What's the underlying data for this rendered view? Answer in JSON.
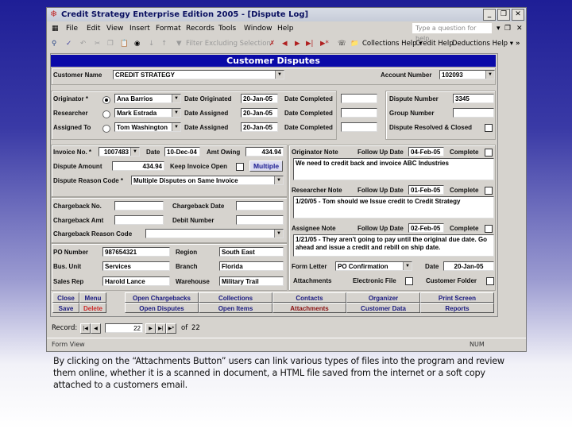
{
  "window": {
    "title": "Credit Strategy Enterprise Edition 2005 - [Dispute Log]",
    "controls": [
      "minimize",
      "restore",
      "close"
    ]
  },
  "menubar": {
    "items": [
      "File",
      "Edit",
      "View",
      "Insert",
      "Format",
      "Records",
      "Tools",
      "Window",
      "Help"
    ],
    "help_placeholder": "Type a question for help"
  },
  "toolbar": {
    "filter_label": "Filter Excluding Selection",
    "collections_help": "Collections Help",
    "credit_help": "Credit Help",
    "deductions_help": "Deductions Help",
    "more": "»"
  },
  "form": {
    "header": "Customer Disputes",
    "customer_name_label": "Customer Name",
    "customer_name": "CREDIT STRATEGY",
    "account_number_label": "Account Number",
    "account_number": "102093",
    "people": [
      {
        "role": "Originator *",
        "name": "Ana Barrios",
        "date_label": "Date Originated",
        "date": "20-Jan-05",
        "completed_label": "Date Completed",
        "completed": "",
        "selected": true
      },
      {
        "role": "Researcher",
        "name": "Mark Estrada",
        "date_label": "Date Assigned",
        "date": "20-Jan-05",
        "completed_label": "Date Completed",
        "completed": "",
        "selected": false
      },
      {
        "role": "Assigned To",
        "name": "Tom Washington",
        "date_label": "Date Assigned",
        "date": "20-Jan-05",
        "completed_label": "Date Completed",
        "completed": "",
        "selected": false
      }
    ],
    "dispute_number_label": "Dispute Number",
    "dispute_number": "3345",
    "group_number_label": "Group Number",
    "group_number": "",
    "resolved_label": "Dispute Resolved & Closed",
    "resolved": false,
    "invoice_no_label": "Invoice No. *",
    "invoice_no": "1007483",
    "date_label": "Date",
    "invoice_date": "10-Dec-04",
    "amt_owing_label": "Amt Owing",
    "amt_owing": "434.94",
    "dispute_amount_label": "Dispute Amount",
    "dispute_amount": "434.94",
    "keep_open_label": "Keep Invoice Open",
    "keep_open": false,
    "multiple_button": "Multiple",
    "reason_code_label": "Dispute Reason Code *",
    "reason_code": "Multiple Disputes on Same Invoice",
    "chargeback_no_label": "Chargeback No.",
    "chargeback_no": "",
    "chargeback_date_label": "Chargeback Date",
    "chargeback_date": "",
    "chargeback_amt_label": "Chargeback Amt",
    "chargeback_amt": "",
    "debit_number_label": "Debit Number",
    "debit_number": "",
    "chargeback_reason_label": "Chargeback Reason Code",
    "chargeback_reason": "",
    "po_number_label": "PO Number",
    "po_number": "987654321",
    "region_label": "Region",
    "region": "South East",
    "bus_unit_label": "Bus. Unit",
    "bus_unit": "Services",
    "branch_label": "Branch",
    "branch": "Florida",
    "sales_rep_label": "Sales Rep",
    "sales_rep": "Harold Lance",
    "warehouse_label": "Warehouse",
    "warehouse": "Military Trail",
    "notes": [
      {
        "label": "Originator Note",
        "followup_label": "Follow Up Date",
        "followup": "04-Feb-05",
        "complete_label": "Complete",
        "text": "We need to credit back and invoice ABC Industries"
      },
      {
        "label": "Researcher Note",
        "followup_label": "Follow Up Date",
        "followup": "01-Feb-05",
        "complete_label": "Complete",
        "text": "1/20/05 - Tom should we Issue credit to Credit Strategy"
      },
      {
        "label": "Assignee Note",
        "followup_label": "Follow Up Date",
        "followup": "02-Feb-05",
        "complete_label": "Complete",
        "text": "1/21/05 - They aren't going to pay until the original due date. Go ahead and issue a credit and rebill on ship date."
      }
    ],
    "form_letter_label": "Form Letter",
    "form_letter": "PO Confirmation",
    "form_letter_date_label": "Date",
    "form_letter_date": "20-Jan-05",
    "attachments_label": "Attachments",
    "electronic_file_label": "Electronic File",
    "customer_folder_label": "Customer Folder",
    "buttons": {
      "close": "Close",
      "menu": "Menu",
      "save": "Save",
      "delete": "Delete",
      "open_chargebacks": "Open Chargebacks",
      "collections": "Collections",
      "contacts": "Contacts",
      "organizer": "Organizer",
      "print_screen": "Print Screen",
      "open_disputes": "Open Disputes",
      "open_items": "Open Items",
      "attachments": "Attachments",
      "customer_data": "Customer Data",
      "reports": "Reports"
    }
  },
  "record_nav": {
    "label": "Record:",
    "current": "22",
    "of_label": "of",
    "total": "22"
  },
  "statusbar": {
    "view": "Form View",
    "num": "NUM"
  },
  "caption": "By clicking on the “Attachments Button” users can link various types of files into the program and review them online, whether it is a scanned in document, a HTML file saved from the internet or a soft copy attached to a customers email."
}
